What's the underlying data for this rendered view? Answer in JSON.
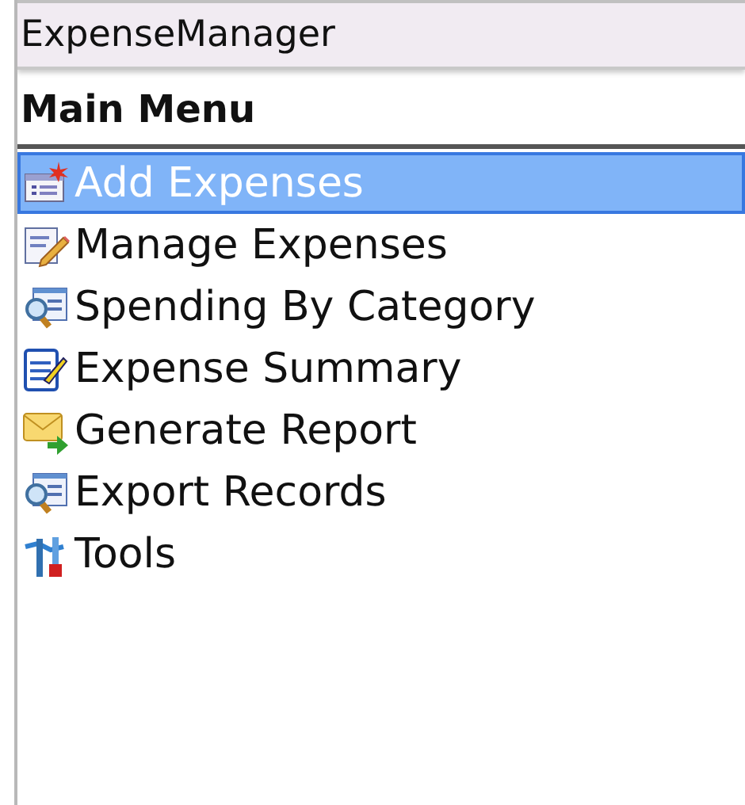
{
  "window": {
    "title": "ExpenseManager"
  },
  "menu": {
    "title": "Main Menu",
    "items": [
      {
        "label": "Add Expenses",
        "kind": "add",
        "selected": true
      },
      {
        "label": "Manage Expenses",
        "kind": "edit",
        "selected": false
      },
      {
        "label": "Spending By Category",
        "kind": "search",
        "selected": false
      },
      {
        "label": "Expense Summary",
        "kind": "notepad",
        "selected": false
      },
      {
        "label": "Generate Report",
        "kind": "mail",
        "selected": false
      },
      {
        "label": "Export Records",
        "kind": "search",
        "selected": false
      },
      {
        "label": "Tools",
        "kind": "tools",
        "selected": false
      }
    ]
  }
}
